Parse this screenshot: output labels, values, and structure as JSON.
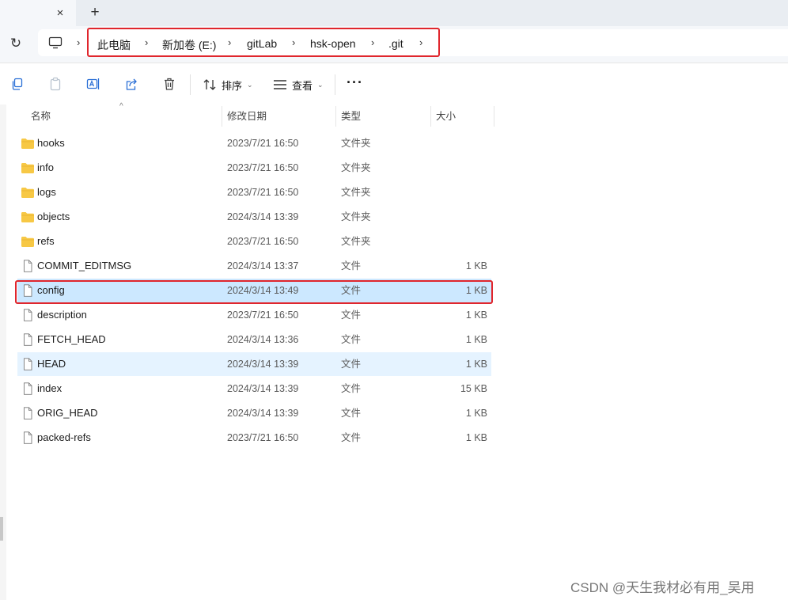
{
  "tabs": {
    "close_glyph": "×",
    "new_tab_glyph": "+"
  },
  "address_bar": {
    "refresh_glyph": "↻",
    "computer_icon": "monitor-icon",
    "breadcrumbs": [
      "此电脑",
      "新加卷 (E:)",
      "gitLab",
      "hsk-open",
      ".git"
    ],
    "separator": "›",
    "highlight_color": "#e0262d"
  },
  "toolbar": {
    "actions": [
      "copy-icon",
      "paste-icon",
      "rename-icon",
      "share-icon",
      "delete-icon"
    ],
    "sort_label": "排序",
    "view_label": "查看",
    "more_label": "···",
    "dropdown_glyph": "⌄"
  },
  "file_list": {
    "columns": {
      "name": "名称",
      "date": "修改日期",
      "type": "类型",
      "size": "大小"
    },
    "sort_glyph": "^",
    "folder_color": "#f7c845",
    "selected_color": "#cce8ff",
    "hover_color": "#e5f3ff",
    "rows": [
      {
        "kind": "folder",
        "name": "hooks",
        "date": "2023/7/21 16:50",
        "type": "文件夹",
        "size": ""
      },
      {
        "kind": "folder",
        "name": "info",
        "date": "2023/7/21 16:50",
        "type": "文件夹",
        "size": ""
      },
      {
        "kind": "folder",
        "name": "logs",
        "date": "2023/7/21 16:50",
        "type": "文件夹",
        "size": ""
      },
      {
        "kind": "folder",
        "name": "objects",
        "date": "2024/3/14 13:39",
        "type": "文件夹",
        "size": ""
      },
      {
        "kind": "folder",
        "name": "refs",
        "date": "2023/7/21 16:50",
        "type": "文件夹",
        "size": ""
      },
      {
        "kind": "file",
        "name": "COMMIT_EDITMSG",
        "date": "2024/3/14 13:37",
        "type": "文件",
        "size": "1 KB"
      },
      {
        "kind": "file",
        "name": "config",
        "date": "2024/3/14 13:49",
        "type": "文件",
        "size": "1 KB",
        "state": "selected"
      },
      {
        "kind": "file",
        "name": "description",
        "date": "2023/7/21 16:50",
        "type": "文件",
        "size": "1 KB"
      },
      {
        "kind": "file",
        "name": "FETCH_HEAD",
        "date": "2024/3/14 13:36",
        "type": "文件",
        "size": "1 KB"
      },
      {
        "kind": "file",
        "name": "HEAD",
        "date": "2024/3/14 13:39",
        "type": "文件",
        "size": "1 KB",
        "state": "hover"
      },
      {
        "kind": "file",
        "name": "index",
        "date": "2024/3/14 13:39",
        "type": "文件",
        "size": "15 KB"
      },
      {
        "kind": "file",
        "name": "ORIG_HEAD",
        "date": "2024/3/14 13:39",
        "type": "文件",
        "size": "1 KB"
      },
      {
        "kind": "file",
        "name": "packed-refs",
        "date": "2023/7/21 16:50",
        "type": "文件",
        "size": "1 KB"
      }
    ]
  },
  "watermark": "CSDN @天生我材必有用_吴用"
}
